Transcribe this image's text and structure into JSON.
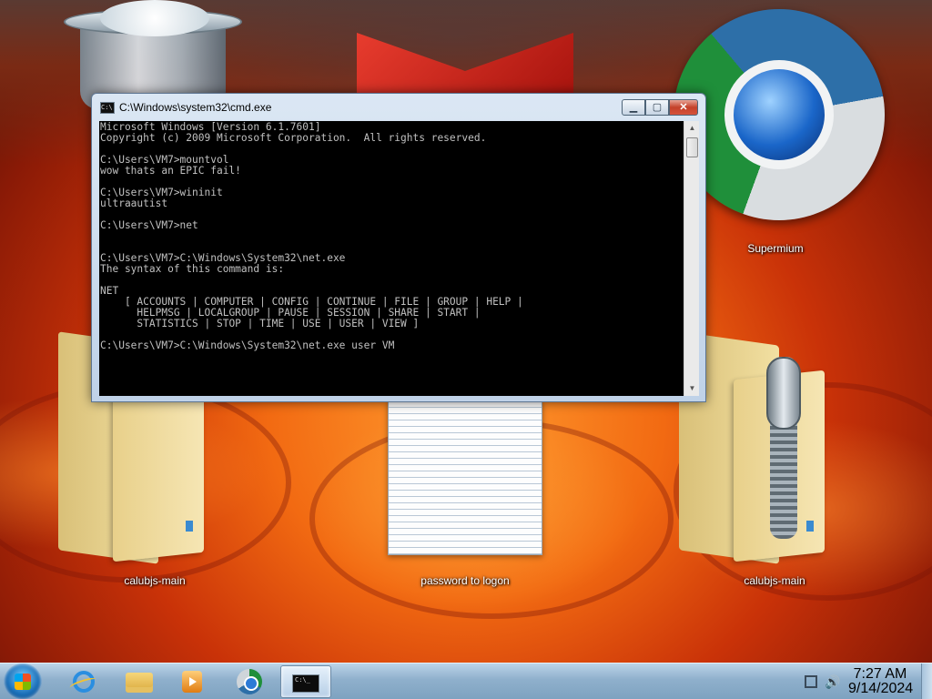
{
  "desktop": {
    "icons": [
      {
        "id": "recycle-bin",
        "label": ""
      },
      {
        "id": "supermium",
        "label": "Supermium"
      },
      {
        "id": "folder-left",
        "label": "calubjs-main"
      },
      {
        "id": "notepad",
        "label": "password to logon"
      },
      {
        "id": "zip-right",
        "label": "calubjs-main"
      }
    ]
  },
  "window": {
    "title": "C:\\Windows\\system32\\cmd.exe",
    "minimize": "▁",
    "maximize": "▢",
    "close": "✕",
    "lines": [
      "Microsoft Windows [Version 6.1.7601]",
      "Copyright (c) 2009 Microsoft Corporation.  All rights reserved.",
      "",
      "C:\\Users\\VM7>mountvol",
      "wow thats an EPIC fail!",
      "",
      "C:\\Users\\VM7>wininit",
      "ultraautist",
      "",
      "C:\\Users\\VM7>net",
      "",
      "",
      "C:\\Users\\VM7>C:\\Windows\\System32\\net.exe",
      "The syntax of this command is:",
      "",
      "NET",
      "    [ ACCOUNTS | COMPUTER | CONFIG | CONTINUE | FILE | GROUP | HELP |",
      "      HELPMSG | LOCALGROUP | PAUSE | SESSION | SHARE | START |",
      "      STATISTICS | STOP | TIME | USE | USER | VIEW ]",
      "",
      "C:\\Users\\VM7>C:\\Windows\\System32\\net.exe user VM"
    ]
  },
  "taskbar": {
    "items": [
      "internet-explorer",
      "windows-explorer",
      "media-player",
      "supermium",
      "command-prompt"
    ],
    "clock": {
      "time": "7:27 AM",
      "date": "9/14/2024"
    }
  },
  "colors": {
    "console_bg": "#000000",
    "console_fg": "#c0c0c0",
    "taskbar": "#8fb0cc"
  }
}
